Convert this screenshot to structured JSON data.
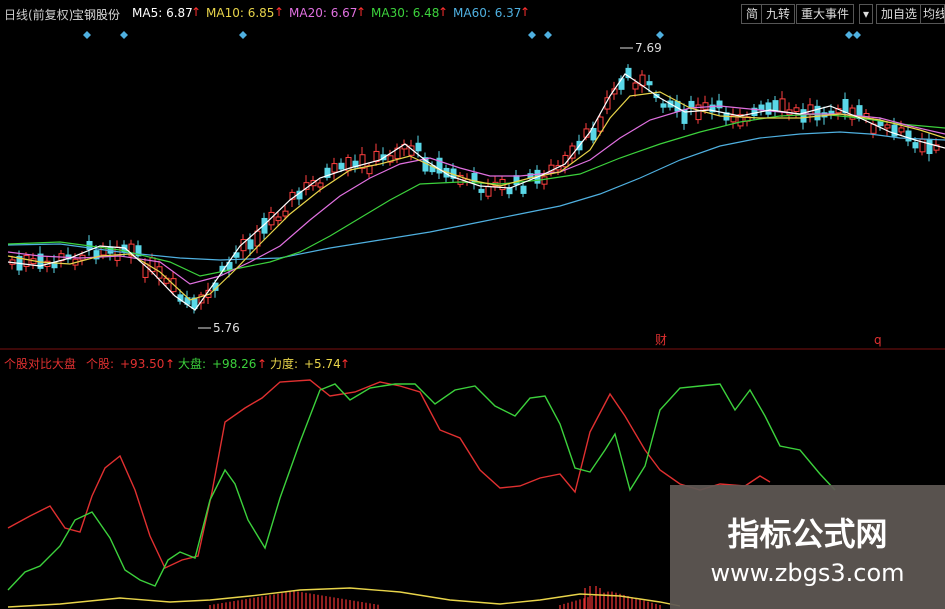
{
  "header": {
    "period": "日线(前复权)",
    "stock": "宝钢股份",
    "ma": [
      {
        "label": "MA5:",
        "value": "6.87",
        "color": "#ffffff"
      },
      {
        "label": "MA10:",
        "value": "6.85",
        "color": "#e8d44a"
      },
      {
        "label": "MA20:",
        "value": "6.67",
        "color": "#e070e0"
      },
      {
        "label": "MA30:",
        "value": "6.48",
        "color": "#3cd13c"
      },
      {
        "label": "MA60:",
        "value": "6.37",
        "color": "#4fb0e0"
      }
    ],
    "buttons": [
      "简",
      "九转",
      "重大事件",
      "▾",
      "加自选",
      "均线"
    ]
  },
  "price_chart": {
    "high_label": "7.69",
    "low_label": "5.76",
    "marker_cai": "财",
    "marker_q": "q"
  },
  "indicator": {
    "name": "个股对比大盘",
    "geg_label": "个股:",
    "geg_value": "+93.50",
    "dapan_label": "大盘:",
    "dapan_value": "+98.26",
    "lidu_label": "力度:",
    "lidu_value": "+5.74",
    "colors": {
      "geg": "#e03030",
      "dapan": "#3cd13c",
      "lidu": "#e8d44a"
    }
  },
  "watermark": {
    "title": "指标公式网",
    "url": "www.zbgs3.com"
  },
  "chart_data": {
    "type": "line",
    "series": [
      {
        "name": "MA5",
        "values": [
          6.87
        ]
      },
      {
        "name": "MA10",
        "values": [
          6.85
        ]
      },
      {
        "name": "MA20",
        "values": [
          6.67
        ]
      },
      {
        "name": "MA30",
        "values": [
          6.48
        ]
      },
      {
        "name": "MA60",
        "values": [
          6.37
        ]
      }
    ],
    "price_high": 7.69,
    "price_low": 5.76,
    "indicator_series": [
      {
        "name": "个股",
        "value": 93.5
      },
      {
        "name": "大盘",
        "value": 98.26
      },
      {
        "name": "力度",
        "value": 5.74
      }
    ]
  }
}
